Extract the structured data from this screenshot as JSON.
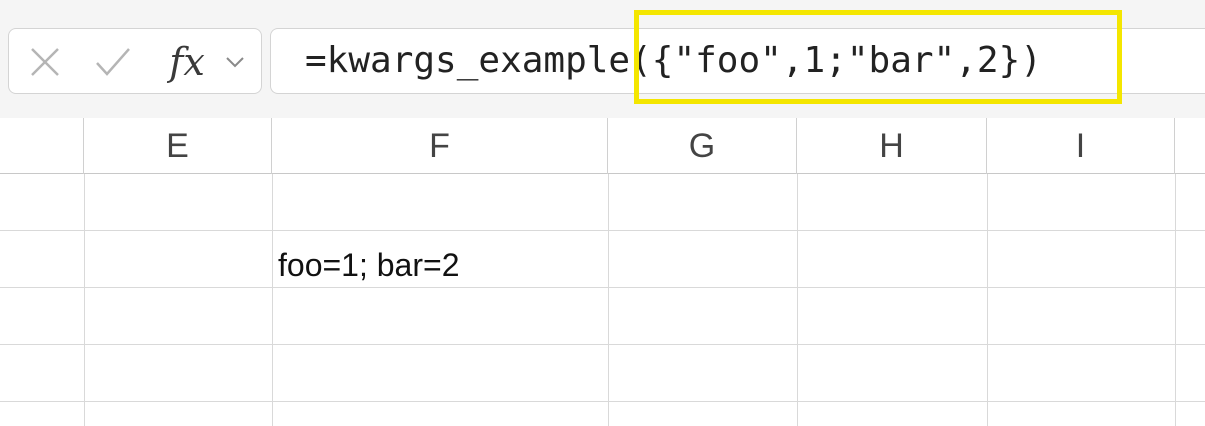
{
  "formula_bar": {
    "cancel_icon": "close-icon",
    "enter_icon": "check-icon",
    "fx_label": "fx",
    "dropdown_icon": "chevron-down-icon",
    "formula": "=kwargs_example({\"foo\",1;\"bar\",2})",
    "highlight_color": "#f4e600"
  },
  "columns": [
    "E",
    "F",
    "G",
    "H",
    "I"
  ],
  "cells": {
    "F2": "foo=1; bar=2"
  },
  "colors": {
    "grid_line": "#d9d9d9",
    "header_text": "#444444",
    "formula_bg": "#f5f5f5"
  }
}
